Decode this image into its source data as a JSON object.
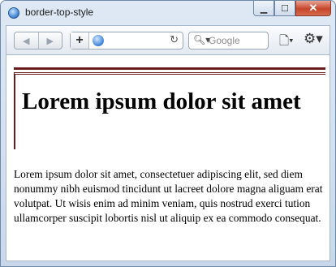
{
  "window": {
    "title": "border-top-style"
  },
  "titlebar_buttons": {
    "minimize": "▁",
    "maximize": "☐",
    "close": "✕"
  },
  "toolbar": {
    "back_icon": "◀",
    "forward_icon": "▶",
    "new_tab_icon": "+",
    "reload_icon": "↻",
    "search_placeholder": "Google",
    "search_icon": "🔍︎▾",
    "page_menu_icon": "🗋▾",
    "tools_menu_icon": "⚙▾"
  },
  "content": {
    "heading": "Lorem ipsum dolor sit amet",
    "paragraph": "Lorem ipsum dolor sit amet, consectetuer adipiscing elit, sed diem nonummy nibh euismod tincidunt ut lacreet dolore magna aliguam erat volutpat. Ut wisis enim ad minim veniam, quis nostrud exerci tution ullamcorper suscipit lobortis nisl ut aliquip ex ea commodo consequat."
  },
  "colors": {
    "border_accent": "#6b1d1d",
    "close_button": "#c7452b"
  }
}
